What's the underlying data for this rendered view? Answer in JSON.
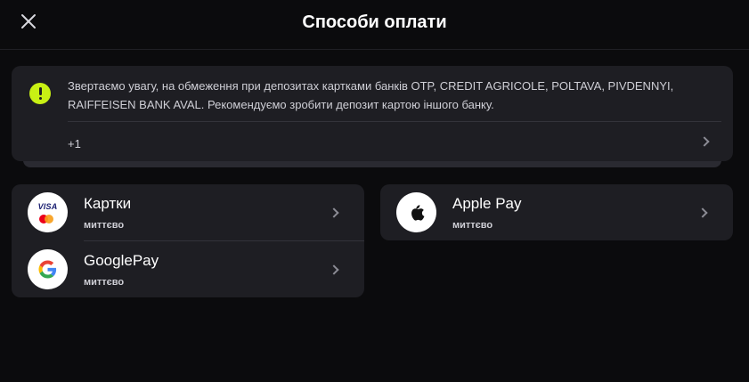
{
  "header": {
    "title": "Способи оплати"
  },
  "notice": {
    "text": "Звертаємо увагу, на обмеження при депозитах картками банків OTP, CREDIT AGRICOLE, POLTAVA, PIVDENNYI, RAIFFEISEN BANK AVAL. Рекомендуємо зробити депозит картою іншого банку.",
    "more": "+1",
    "icon": "warning-icon",
    "accent": "#c8f014"
  },
  "methods": [
    {
      "name": "Картки",
      "sub": "миттєво",
      "icon": "visa-mastercard-icon"
    },
    {
      "name": "GooglePay",
      "sub": "миттєво",
      "icon": "google-icon"
    },
    {
      "name": "Apple Pay",
      "sub": "миттєво",
      "icon": "apple-icon"
    }
  ],
  "icons": {
    "visa_label": "VISA"
  },
  "colors": {
    "background": "#0b0b0d",
    "card": "#1e1e23"
  }
}
